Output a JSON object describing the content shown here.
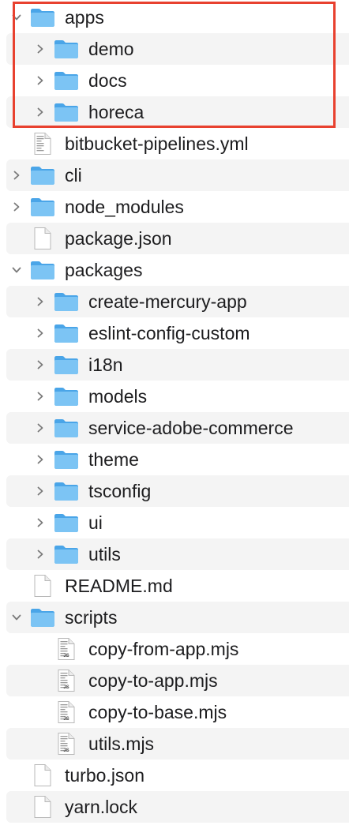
{
  "tree": [
    {
      "name": "apps",
      "type": "folder",
      "depth": 0,
      "expanded": true
    },
    {
      "name": "demo",
      "type": "folder",
      "depth": 1,
      "expanded": false
    },
    {
      "name": "docs",
      "type": "folder",
      "depth": 1,
      "expanded": false
    },
    {
      "name": "horeca",
      "type": "folder",
      "depth": 1,
      "expanded": false
    },
    {
      "name": "bitbucket-pipelines.yml",
      "type": "text-file",
      "depth": 0
    },
    {
      "name": "cli",
      "type": "folder",
      "depth": 0,
      "expanded": false
    },
    {
      "name": "node_modules",
      "type": "folder",
      "depth": 0,
      "expanded": false
    },
    {
      "name": "package.json",
      "type": "file",
      "depth": 0
    },
    {
      "name": "packages",
      "type": "folder",
      "depth": 0,
      "expanded": true
    },
    {
      "name": "create-mercury-app",
      "type": "folder",
      "depth": 1,
      "expanded": false
    },
    {
      "name": "eslint-config-custom",
      "type": "folder",
      "depth": 1,
      "expanded": false
    },
    {
      "name": "i18n",
      "type": "folder",
      "depth": 1,
      "expanded": false
    },
    {
      "name": "models",
      "type": "folder",
      "depth": 1,
      "expanded": false
    },
    {
      "name": "service-adobe-commerce",
      "type": "folder",
      "depth": 1,
      "expanded": false
    },
    {
      "name": "theme",
      "type": "folder",
      "depth": 1,
      "expanded": false
    },
    {
      "name": "tsconfig",
      "type": "folder",
      "depth": 1,
      "expanded": false
    },
    {
      "name": "ui",
      "type": "folder",
      "depth": 1,
      "expanded": false
    },
    {
      "name": "utils",
      "type": "folder",
      "depth": 1,
      "expanded": false
    },
    {
      "name": "README.md",
      "type": "file",
      "depth": 0
    },
    {
      "name": "scripts",
      "type": "folder",
      "depth": 0,
      "expanded": true
    },
    {
      "name": "copy-from-app.mjs",
      "type": "js-file",
      "depth": 1,
      "badge": "JS"
    },
    {
      "name": "copy-to-app.mjs",
      "type": "js-file",
      "depth": 1,
      "badge": "JS"
    },
    {
      "name": "copy-to-base.mjs",
      "type": "js-file",
      "depth": 1,
      "badge": "JS"
    },
    {
      "name": "utils.mjs",
      "type": "js-file",
      "depth": 1,
      "badge": "JS"
    },
    {
      "name": "turbo.json",
      "type": "file",
      "depth": 0
    },
    {
      "name": "yarn.lock",
      "type": "file",
      "depth": 0
    }
  ],
  "colors": {
    "folder_body": "#7cc4f4",
    "folder_tab": "#4aa5e8",
    "stripe": "#f4f4f4",
    "highlight_border": "#e8412f",
    "chevron": "#7a7a7a"
  }
}
